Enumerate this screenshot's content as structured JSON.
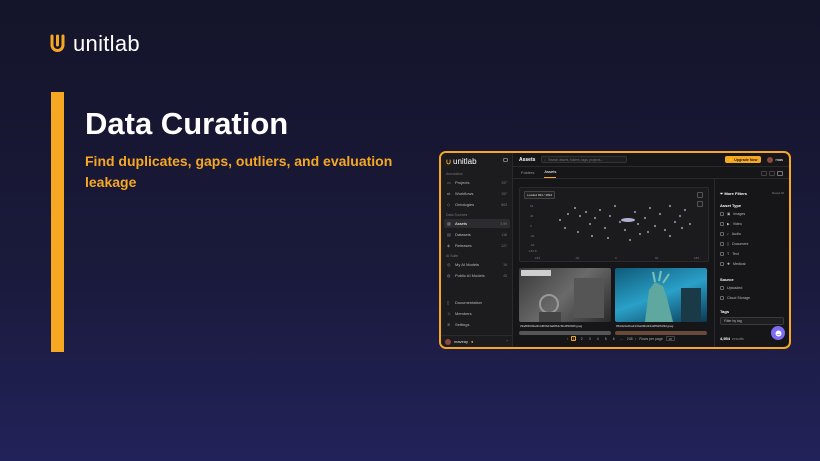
{
  "brand": {
    "name": "unitlab",
    "color": "#f7a823"
  },
  "slide": {
    "title": "Data Curation",
    "subtitle": "Find duplicates, gaps, outliers, and evaluation leakage"
  },
  "app": {
    "logo": "unitlab",
    "sidebar": {
      "section_annotation": "Annotation",
      "section_data": "Data Sources",
      "section_ai": "AI Suite",
      "items_annotation": [
        {
          "label": "Projects",
          "count": "197"
        },
        {
          "label": "Workflows",
          "count": "157"
        },
        {
          "label": "Ontologies",
          "count": "863"
        }
      ],
      "items_data": [
        {
          "label": "Assets",
          "count": "4,99"
        },
        {
          "label": "Datasets",
          "count": "116"
        },
        {
          "label": "Releases",
          "count": "127"
        }
      ],
      "items_ai": [
        {
          "label": "My AI Models",
          "count": "19"
        },
        {
          "label": "Public AI Models",
          "count": "45"
        }
      ],
      "items_bottom": [
        {
          "label": "Documentation"
        },
        {
          "label": "Members"
        },
        {
          "label": "Settings"
        }
      ],
      "user": "maveay"
    },
    "topbar": {
      "title": "Assets",
      "search_placeholder": "Search assets, folders, tags, projects...",
      "upgrade_label": "Upgrade Now",
      "user": "mas"
    },
    "tabs": [
      {
        "label": "Folders",
        "active": false
      },
      {
        "label": "Assets",
        "active": true
      }
    ],
    "scatter": {
      "badge": "Loaded 993 / 4994",
      "x_ticks": [
        "-183",
        "-92",
        "0",
        "92",
        "183"
      ],
      "y_ticks": [
        "92",
        "46",
        "0",
        "-46",
        "-92",
        "-183.8"
      ]
    },
    "thumbnails": [
      {
        "name": "29a8f4649a4b4d66bd3a08b4c6fe0f90b06.jpeg"
      },
      {
        "name": "95d3e6e0ba244ba39bd4342ff62f933d.jpeg"
      }
    ],
    "pagination": {
      "pages": [
        "1",
        "2",
        "3",
        "4",
        "5",
        "6",
        "...",
        "248"
      ],
      "rows_label": "Rows per page",
      "rows_value": "20"
    },
    "filters": {
      "title": "More Filters",
      "reset": "Reset All",
      "asset_type_label": "Asset Type",
      "asset_types": [
        "Images",
        "Video",
        "Audio",
        "Document",
        "Text",
        "Medical"
      ],
      "source_label": "Source",
      "sources": [
        "Uploaded",
        "Cloud Storage"
      ],
      "tags_label": "Tags",
      "tags_placeholder": "Filter by tag",
      "result_count": "4,954",
      "result_label": "results"
    }
  }
}
